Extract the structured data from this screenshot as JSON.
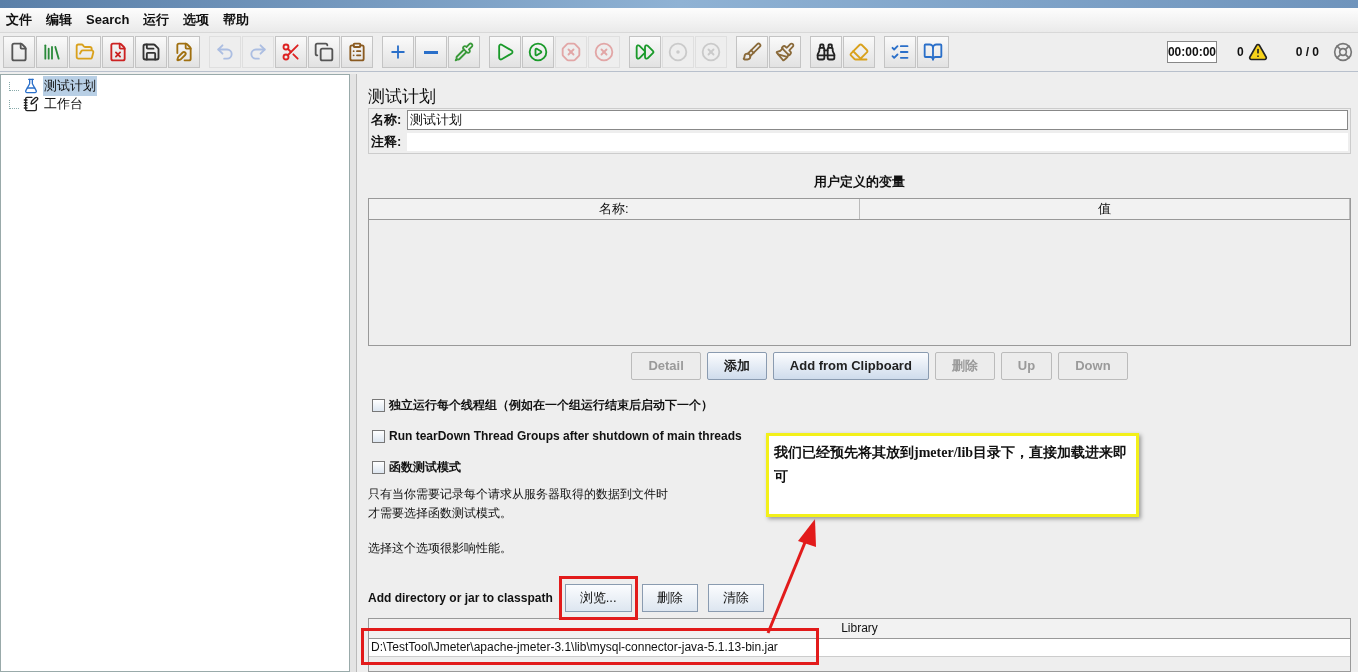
{
  "menu": [
    "文件",
    "编辑",
    "Search",
    "运行",
    "选项",
    "帮助"
  ],
  "toolbar": [
    [
      {
        "disabled": false
      },
      {
        "disabled": false
      },
      {
        "disabled": false
      },
      {
        "disabled": false
      },
      {
        "disabled": false
      },
      {
        "disabled": false
      }
    ],
    [
      {
        "disabled": true
      },
      {
        "disabled": true
      },
      {
        "disabled": false
      },
      {
        "disabled": false
      },
      {
        "disabled": false
      }
    ],
    [
      {
        "disabled": false
      },
      {
        "disabled": false
      },
      {
        "disabled": false
      }
    ],
    [
      {
        "disabled": false
      },
      {
        "disabled": false
      },
      {
        "disabled": true
      },
      {
        "disabled": true
      }
    ],
    [
      {
        "disabled": false
      },
      {
        "disabled": true
      },
      {
        "disabled": true
      }
    ],
    [
      {
        "disabled": false
      },
      {
        "disabled": false
      }
    ],
    [
      {
        "disabled": false
      },
      {
        "disabled": false
      }
    ],
    [
      {
        "disabled": false
      },
      {
        "disabled": false
      }
    ]
  ],
  "status": {
    "timer": "00:00:00",
    "warnings": "0",
    "threads": "0 / 0"
  },
  "tree": [
    {
      "label": "测试计划",
      "kind": "plan",
      "selected": true
    },
    {
      "label": "工作台",
      "kind": "workbench",
      "selected": false
    }
  ],
  "panel": {
    "title": "测试计划",
    "name_label": "名称:",
    "name_value": "测试计划",
    "comment_label": "注释:",
    "variables": {
      "title": "用户定义的变量",
      "columns": [
        "名称:",
        "值"
      ]
    },
    "buttons": [
      {
        "label": "Detail",
        "disabled": true
      },
      {
        "label": "添加",
        "disabled": false
      },
      {
        "label": "Add from Clipboard",
        "disabled": false
      },
      {
        "label": "删除",
        "disabled": true
      },
      {
        "label": "Up",
        "disabled": true
      },
      {
        "label": "Down",
        "disabled": true
      }
    ],
    "options": [
      {
        "label": "独立运行每个线程组（例如在一个组运行结束后启动下一个）",
        "checked": false
      },
      {
        "label": "Run tearDown Thread Groups after shutdown of main threads",
        "checked": false
      },
      {
        "label": "函数测试模式",
        "checked": false
      }
    ],
    "notes": [
      "只有当你需要记录每个请求从服务器取得的数据到文件时",
      "才需要选择函数测试模式。",
      "选择这个选项很影响性能。"
    ],
    "classpath_label": "Add directory or jar to classpath",
    "classpath_buttons": [
      {
        "label": "浏览...",
        "highlighted": true
      },
      {
        "label": "删除"
      },
      {
        "label": "清除"
      }
    ],
    "library": {
      "column": "Library",
      "rows": [
        {
          "path": "D:\\TestTool\\Jmeter\\apache-jmeter-3.1\\lib\\mysql-connector-java-5.1.13-bin.jar",
          "highlighted": true
        }
      ]
    }
  },
  "callout": {
    "text": "我们已经预先将其放到jmeter/lib目录下，直接加载进来即可"
  }
}
